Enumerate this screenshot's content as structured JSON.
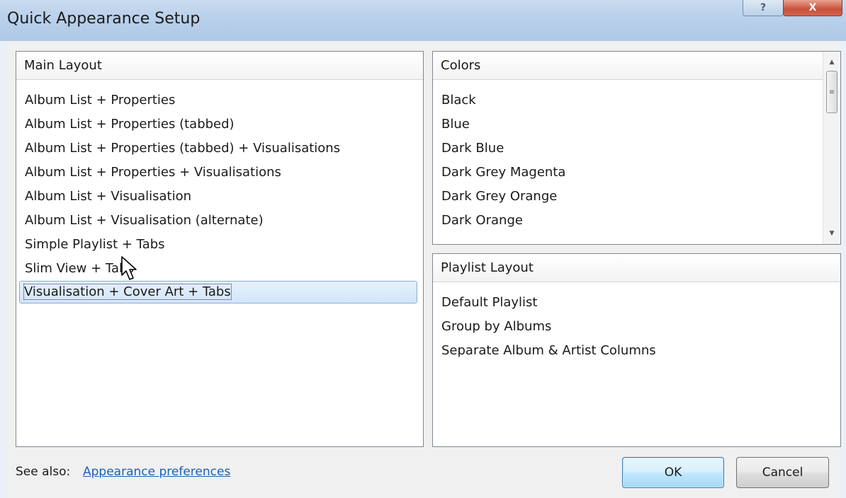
{
  "window": {
    "title": "Quick Appearance Setup",
    "help_glyph": "?",
    "close_glyph": "X"
  },
  "main_layout": {
    "header": "Main Layout",
    "items": [
      "Album List + Properties",
      "Album List + Properties (tabbed)",
      "Album List + Properties (tabbed) + Visualisations",
      "Album List + Properties + Visualisations",
      "Album List + Visualisation",
      "Album List + Visualisation (alternate)",
      "Simple Playlist + Tabs",
      "Slim View + Tabs",
      "Visualisation + Cover Art + Tabs"
    ],
    "selected_index": 8
  },
  "colors": {
    "header": "Colors",
    "items": [
      "Black",
      "Blue",
      "Dark Blue",
      "Dark Grey Magenta",
      "Dark Grey Orange",
      "Dark Orange"
    ]
  },
  "playlist_layout": {
    "header": "Playlist Layout",
    "items": [
      "Default Playlist",
      "Group by Albums",
      "Separate Album & Artist Columns"
    ]
  },
  "footer": {
    "see_also_label": "See also:",
    "link_text": "Appearance preferences",
    "ok_label": "OK",
    "cancel_label": "Cancel"
  },
  "icons": {
    "help": "help-icon",
    "close": "close-icon",
    "scroll_up": "scroll-up-arrow-icon",
    "scroll_down": "scroll-down-arrow-icon",
    "cursor": "mouse-pointer-icon"
  },
  "theme": {
    "accent_link": "#1f5fb5",
    "selection_border": "#84acdd",
    "ok_border": "#3c7fb1"
  }
}
